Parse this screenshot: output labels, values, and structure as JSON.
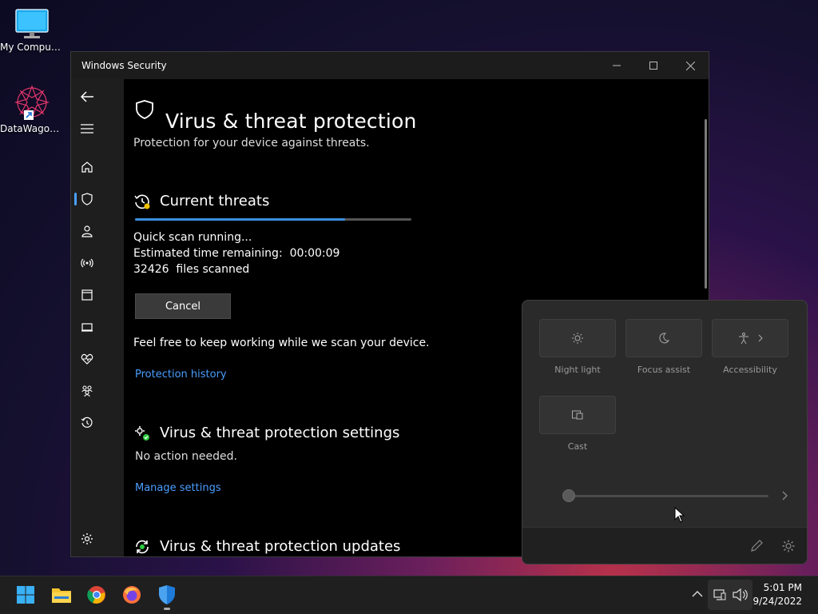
{
  "desktop": {
    "icons": [
      {
        "label": "My Computer"
      },
      {
        "label": "DataWagon..."
      }
    ]
  },
  "window": {
    "title": "Windows Security"
  },
  "nav": {
    "items": [
      "back-icon",
      "menu-icon",
      "home-icon",
      "shield-icon",
      "account-icon",
      "firewall-icon",
      "app-browser-icon",
      "device-security-icon",
      "health-icon",
      "family-icon",
      "history-icon",
      "settings-icon"
    ]
  },
  "page": {
    "title": "Virus & threat protection",
    "subtitle": "Protection for your device against threats."
  },
  "current_threats": {
    "heading": "Current threats",
    "progress": 0.76,
    "status": "Quick scan running...",
    "time_remaining": "Estimated time remaining:  00:00:09",
    "files_scanned": "32426  files scanned",
    "cancel_label": "Cancel",
    "note": "Feel free to keep working while we scan your device.",
    "history_link": "Protection history"
  },
  "settings_section": {
    "heading": "Virus & threat protection settings",
    "status": "No action needed.",
    "link": "Manage settings"
  },
  "updates_section": {
    "heading": "Virus & threat protection updates"
  },
  "quick_settings": {
    "tiles": [
      {
        "label": "Night light",
        "icon": "sun-icon"
      },
      {
        "label": "Focus assist",
        "icon": "moon-icon"
      },
      {
        "label": "Accessibility",
        "icon": "accessibility-icon"
      },
      {
        "label": "Cast",
        "icon": "cast-icon"
      }
    ],
    "brightness": 0.0
  },
  "taskbar": {
    "time": "5:01 PM",
    "date": "9/24/2022"
  },
  "colors": {
    "accent": "#3a8fe0",
    "link": "#4a9eff"
  }
}
